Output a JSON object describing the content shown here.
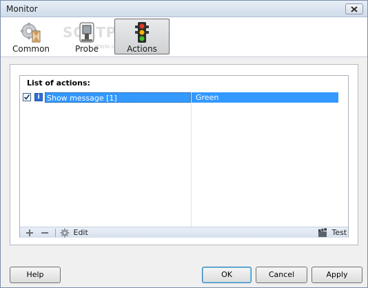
{
  "window": {
    "title": "Monitor"
  },
  "toolbar": {
    "buttons": [
      {
        "label": "Common",
        "icon": "gear-hourglass-icon"
      },
      {
        "label": "Probe",
        "icon": "probe-icon"
      },
      {
        "label": "Actions",
        "icon": "traffic-light-icon",
        "active": true
      }
    ],
    "watermark": "SOFTPEDIA",
    "watermark_sub": "www.softpedia.com"
  },
  "actions_panel": {
    "title": "List of actions:",
    "rows": [
      {
        "checked": true,
        "icon": "info-icon",
        "action": "Show message [1]",
        "condition": "Green"
      }
    ],
    "footer": {
      "edit_label": "Edit",
      "test_label": "Test"
    }
  },
  "buttons": {
    "help": "Help",
    "ok": "OK",
    "cancel": "Cancel",
    "apply": "Apply"
  },
  "colors": {
    "selection": "#3399ff",
    "active_tab": "#cfd1d3"
  }
}
